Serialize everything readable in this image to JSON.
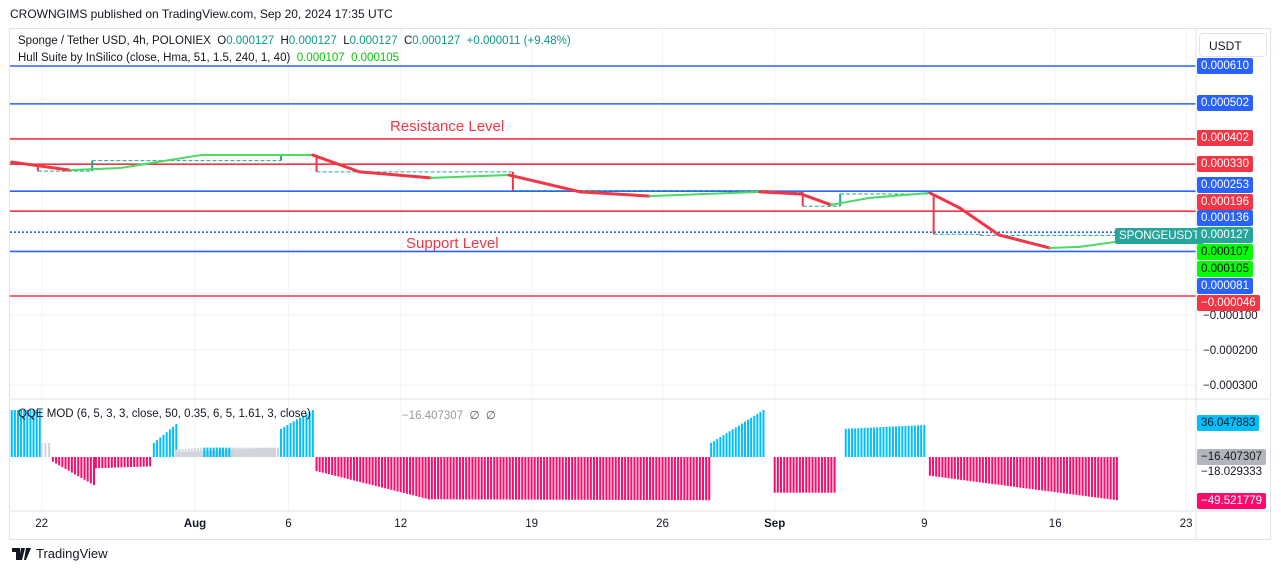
{
  "header": {
    "published": "CROWNGIMS published on TradingView.com, Sep 20, 2024 17:35 UTC"
  },
  "legend": {
    "symbol": "Sponge / Tether USD, 4h, POLONIEX",
    "o_label": "O",
    "o": "0.000127",
    "h_label": "H",
    "h": "0.000127",
    "l_label": "L",
    "l": "0.000127",
    "c_label": "C",
    "c": "0.000127",
    "change": "+0.000011 (+9.48%)",
    "hull_name": "Hull Suite by InSilico (close, Hma, 51, 1.5, 240, 1, 40)",
    "hull_v1": "0.000107",
    "hull_v2": "0.000105"
  },
  "currency": "USDT",
  "annotations": {
    "resistance": "Resistance Level",
    "support": "Support Level",
    "symbol_tag": "SPONGEUSDT"
  },
  "qqe": {
    "name": "QQE MOD (6, 5, 3, 3, close, 50, 0.35, 6, 5, 1.61, 3, close)",
    "value": "−16.407307",
    "na1": "∅",
    "na2": "∅"
  },
  "footer": {
    "brand": "TradingView"
  },
  "colors": {
    "blue": "#2962ff",
    "red": "#f23645",
    "teal": "#26a69a",
    "green": "#00ff00",
    "qqe_blue": "#00bfff",
    "qqe_pink": "#ff0a6c",
    "qqe_grey": "#d1d4dc"
  },
  "chart_data": {
    "type": "line",
    "price_ylim": [
      -0.00033,
      0.00068
    ],
    "price_ticks": [
      "−0.000100",
      "−0.000200",
      "−0.000300"
    ],
    "price_tick_values": [
      -0.0001,
      -0.0002,
      -0.0003
    ],
    "levels": [
      {
        "value": 0.00061,
        "label": "0.000610",
        "color": "blue"
      },
      {
        "value": 0.000502,
        "label": "0.000502",
        "color": "blue"
      },
      {
        "value": 0.000402,
        "label": "0.000402",
        "color": "red"
      },
      {
        "value": 0.00033,
        "label": "0.000330",
        "color": "red"
      },
      {
        "value": 0.000253,
        "label": "0.000253",
        "color": "blue"
      },
      {
        "value": 0.000196,
        "label": "0.000196",
        "color": "red"
      },
      {
        "value": 0.000136,
        "label": "0.000136",
        "color": "blue"
      },
      {
        "value": 8.1e-05,
        "label": "0.000081",
        "color": "blue"
      },
      {
        "value": -4.6e-05,
        "label": "−0.000046",
        "color": "red"
      }
    ],
    "axis_labels": [
      {
        "label": "0.000127",
        "color": "teal"
      },
      {
        "label": "0.000107",
        "color": "green"
      },
      {
        "label": "0.000105",
        "color": "green"
      }
    ],
    "x_ticks": [
      {
        "day": -8.2,
        "label": "22"
      },
      {
        "day": 0,
        "label": "Aug"
      },
      {
        "day": 5,
        "label": "6"
      },
      {
        "day": 11,
        "label": "12"
      },
      {
        "day": 18,
        "label": "19"
      },
      {
        "day": 25,
        "label": "26"
      },
      {
        "day": 31,
        "label": "Sep"
      },
      {
        "day": 39,
        "label": "9"
      },
      {
        "day": 46,
        "label": "16"
      },
      {
        "day": 53,
        "label": "23"
      }
    ],
    "hull": [
      [
        -9.8,
        0.000336
      ],
      [
        -6.7,
        0.000313
      ],
      [
        -4,
        0.000319
      ],
      [
        0.3,
        0.000356
      ],
      [
        4.5,
        0.000356
      ],
      [
        6.3,
        0.000356
      ],
      [
        8.8,
        0.000308
      ],
      [
        12.6,
        0.000291
      ],
      [
        16.8,
        0.000299
      ],
      [
        20.6,
        0.000251
      ],
      [
        24.3,
        0.000239
      ],
      [
        30.2,
        0.000251
      ],
      [
        32.4,
        0.000245
      ],
      [
        34,
        0.000214
      ],
      [
        36.1,
        0.000234
      ],
      [
        39.3,
        0.000248
      ],
      [
        40.9,
        0.000205
      ],
      [
        43,
        0.000128
      ],
      [
        45.7,
        9.1e-05
      ],
      [
        47.3,
        9.4e-05
      ],
      [
        49.2,
        0.000108
      ]
    ],
    "price_steps": [
      [
        -9.8,
        0.00033
      ],
      [
        -8.4,
        0.00031
      ],
      [
        -5.5,
        0.00034
      ],
      [
        -4.2,
        0.00034
      ],
      [
        4.6,
        0.000356
      ],
      [
        6.5,
        0.000308
      ],
      [
        17,
        0.000255
      ],
      [
        30.7,
        0.00025
      ],
      [
        32.5,
        0.00021
      ],
      [
        34.5,
        0.000245
      ],
      [
        39.5,
        0.00013
      ],
      [
        42,
        0.000127
      ],
      [
        49.5,
        0.000127
      ]
    ],
    "qqe_ylim": [
      -60,
      55
    ],
    "qqe_ticks": [
      {
        "value": 36.047883,
        "label": "36.047883",
        "color": "qqe_blue"
      },
      {
        "value": -16.407307,
        "label": "−16.407307",
        "color": "grey"
      },
      {
        "value": -18.029333,
        "label": "−18.029333",
        "color": "none"
      },
      {
        "value": -49.521779,
        "label": "−49.521779",
        "color": "qqe_pink"
      }
    ],
    "qqe_segments": [
      [
        -9.8,
        -8.3,
        50,
        50,
        "qqe_blue"
      ],
      [
        -8.2,
        -7.8,
        15,
        15,
        "qqe_grey"
      ],
      [
        -7.6,
        -5.4,
        -5,
        -30,
        "qqe_pink"
      ],
      [
        -5.3,
        -2.4,
        -12,
        -10,
        "qqe_pink"
      ],
      [
        -2.2,
        -1,
        15,
        35,
        "qqe_blue"
      ],
      [
        -0.9,
        4.2,
        5,
        10,
        "qqe_grey"
      ],
      [
        -1,
        0.5,
        8,
        10,
        "qqe_grey"
      ],
      [
        0.5,
        2,
        10,
        10,
        "qqe_blue"
      ],
      [
        2,
        4.6,
        10,
        10,
        "qqe_grey"
      ],
      [
        4.6,
        6.3,
        30,
        50,
        "qqe_blue"
      ],
      [
        6.5,
        12.5,
        -15,
        -45,
        "qqe_pink"
      ],
      [
        12.5,
        27.5,
        -45,
        -46,
        "qqe_pink"
      ],
      [
        27.6,
        30.4,
        15,
        50,
        "qqe_blue"
      ],
      [
        31,
        34.2,
        -38,
        -38,
        "qqe_pink"
      ],
      [
        34.8,
        39,
        30,
        34,
        "qqe_blue"
      ],
      [
        39.3,
        49.3,
        -20,
        -46,
        "qqe_pink"
      ]
    ]
  }
}
